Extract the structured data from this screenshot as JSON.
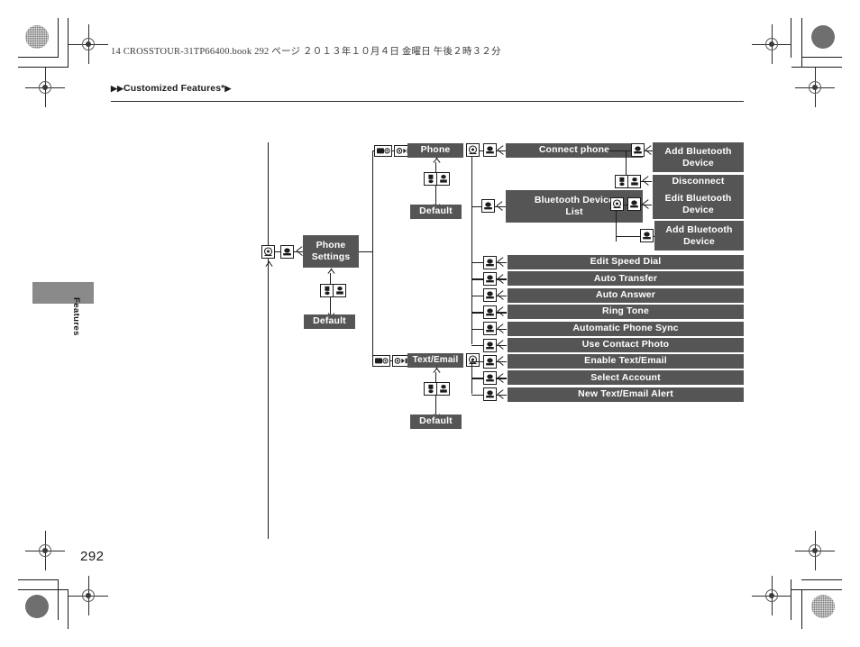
{
  "header": {
    "file_line": "14 CROSSTOUR-31TP66400.book   292 ページ   ２０１３年１０月４日   金曜日   午後２時３２分",
    "breadcrumb_prefix": "▶▶",
    "breadcrumb_title": "Customized Features",
    "breadcrumb_star": "*",
    "breadcrumb_suffix": "▶"
  },
  "side_tab": {
    "label": "Features"
  },
  "footer": {
    "page_number": "292"
  },
  "colors": {
    "node_fill": "#555555",
    "node_text": "#ffffff",
    "line": "#1c1c1c",
    "tab_fill": "#8a8a8a"
  },
  "diagram": {
    "type": "tree",
    "root": "Phone Settings",
    "nodes": {
      "phone_settings": "Phone\nSettings",
      "phone_settings_l1": "Phone",
      "phone_settings_l2": "Settings",
      "default_root": "Default",
      "phone": "Phone",
      "default_phone": "Default",
      "text_email": "Text/Email",
      "default_text_email": "Default",
      "connect_phone": "Connect phone",
      "add_bluetooth_device_1a": "Add Bluetooth",
      "add_bluetooth_device_1b": "Device",
      "disconnect": "Disconnect",
      "bluetooth_device_list_a": "Bluetooth Device",
      "bluetooth_device_list_b": "List",
      "edit_bluetooth_device_a": "Edit Bluetooth",
      "edit_bluetooth_device_b": "Device",
      "add_bluetooth_device_2a": "Add Bluetooth",
      "add_bluetooth_device_2b": "Device",
      "edit_speed_dial": "Edit Speed Dial",
      "auto_transfer": "Auto Transfer",
      "auto_answer": "Auto Answer",
      "ring_tone": "Ring Tone",
      "automatic_phone_sync": "Automatic Phone Sync",
      "use_contact_photo": "Use Contact Photo",
      "enable_text_email": "Enable Text/Email",
      "select_account": "Select Account",
      "new_text_email_alert": "New Text/Email Alert"
    },
    "icons": {
      "dial": "rotary-dial-icon",
      "enter": "enter-knob-icon",
      "back": "back-button-icon",
      "wide_left": "display-button-wide-icon",
      "wide_right": "menu-button-wide-icon"
    }
  }
}
